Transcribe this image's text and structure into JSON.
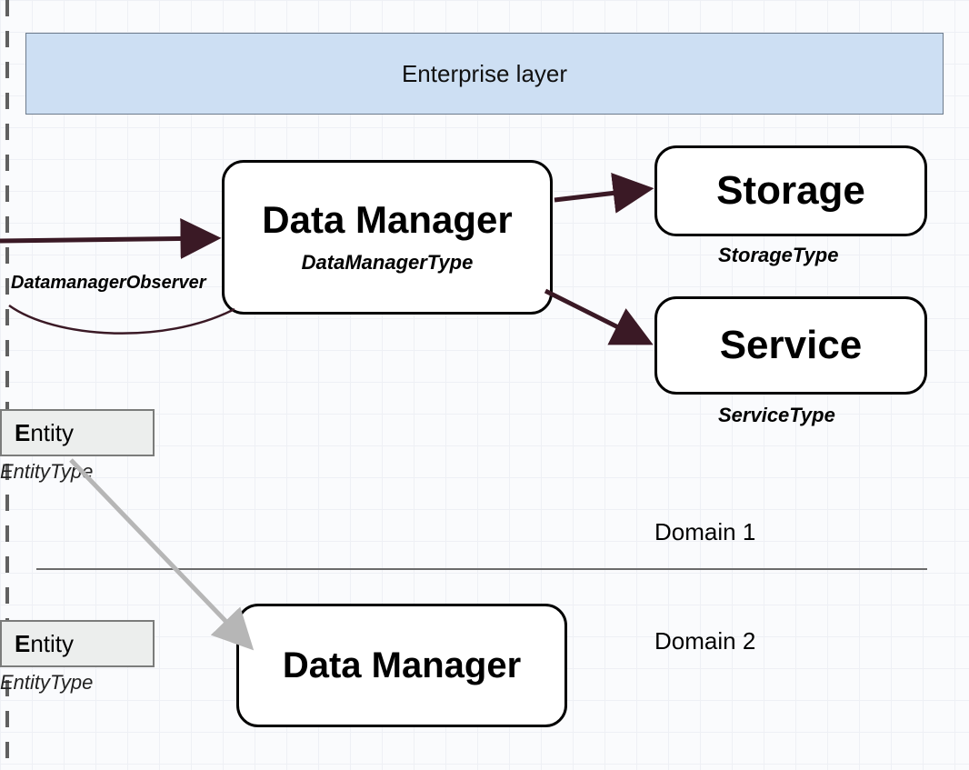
{
  "header": {
    "title": "Enterprise layer"
  },
  "dataManager1": {
    "title": "Data Manager",
    "subtype": "DataManagerType"
  },
  "dataManager2": {
    "title": "Data Manager"
  },
  "storage": {
    "title": "Storage",
    "subtype": "StorageType"
  },
  "service": {
    "title": "Service",
    "subtype": "ServiceType"
  },
  "observerLabel": "DatamanagerObserver",
  "entity1": {
    "cap": "E",
    "rest": "ntity",
    "subtype": "EntityType"
  },
  "entity2": {
    "cap": "E",
    "rest": "ntity",
    "subtype": "EntityType"
  },
  "domain1": "Domain 1",
  "domain2": "Domain 2"
}
